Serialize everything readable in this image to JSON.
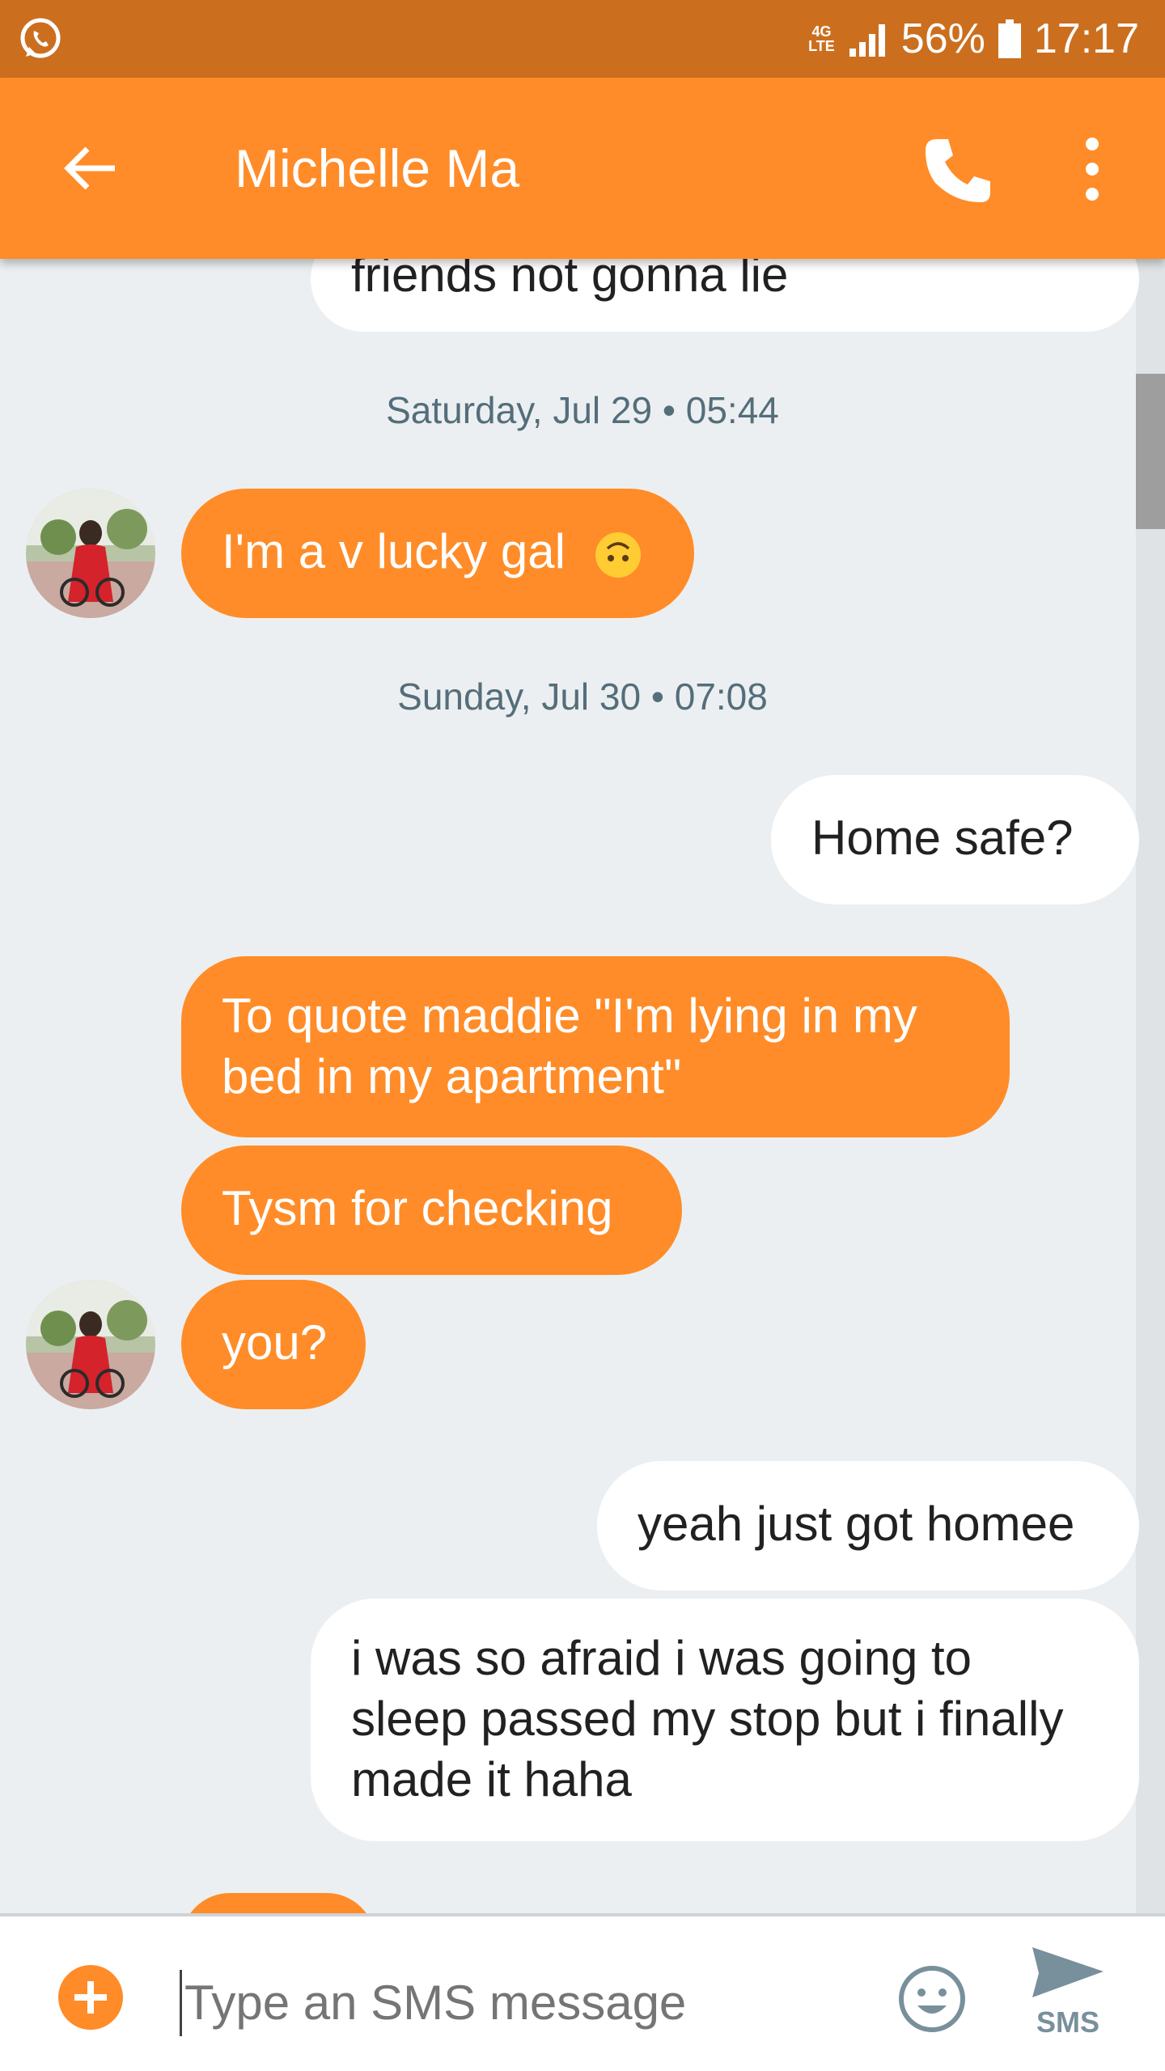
{
  "status_bar": {
    "network": "4G LTE",
    "battery": "56%",
    "time": "17:17"
  },
  "app_bar": {
    "title": "Michelle Ma"
  },
  "messages": [
    {
      "side": "out",
      "text": "friends not gonna lie"
    },
    {
      "timestamp": "Saturday, Jul 29 • 05:44"
    },
    {
      "side": "in",
      "text": "I'm a v lucky gal",
      "emoji": "upside-down-face-emoji"
    },
    {
      "timestamp": "Sunday, Jul 30 • 07:08"
    },
    {
      "side": "out",
      "text": "Home safe?"
    },
    {
      "side": "in",
      "text": "To quote maddie \"I'm lying in my bed in my apartment\""
    },
    {
      "side": "in",
      "text": "Tysm for checking"
    },
    {
      "side": "in",
      "text": "you?"
    },
    {
      "side": "out",
      "text": "yeah just got homee"
    },
    {
      "side": "out",
      "text": "i was so afraid i was going to sleep passed my stop but i finally made it haha"
    }
  ],
  "composer": {
    "placeholder": "Type an SMS message",
    "send_label": "SMS"
  },
  "colors": {
    "status_bar": "#cb6f1f",
    "app_bar": "#ff8c28",
    "incoming_bubble": "#ff8c28",
    "outgoing_bubble": "#ffffff",
    "background": "#eceff1"
  }
}
